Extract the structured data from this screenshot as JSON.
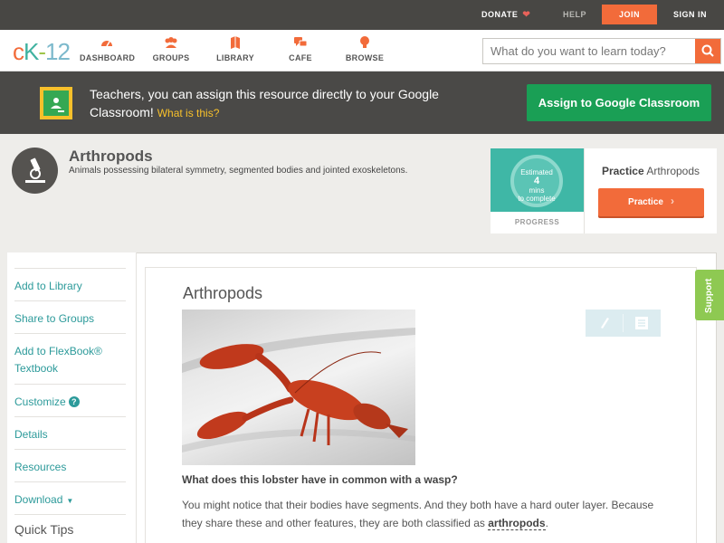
{
  "topbar": {
    "donate": "DONATE",
    "help": "HELP",
    "join": "JOIN",
    "signin": "SIGN IN"
  },
  "logo": {
    "c": "c",
    "k": "K",
    "dash": "-",
    "num": "12"
  },
  "nav": {
    "dashboard": "DASHBOARD",
    "groups": "GROUPS",
    "library": "LIBRARY",
    "cafe": "CAFE",
    "browse": "BROWSE"
  },
  "search": {
    "placeholder": "What do you want to learn today?"
  },
  "banner": {
    "text": "Teachers, you can assign this resource directly to your Google Classroom!",
    "what": "What is this?",
    "assign": "Assign to Google Classroom"
  },
  "concept": {
    "title": "Arthropods",
    "description": "Animals possessing bilateral symmetry, segmented bodies and jointed exoskeletons."
  },
  "practice": {
    "ring_line1": "Estimated",
    "ring_mins": "4",
    "ring_unit": "mins",
    "ring_line3": "to complete",
    "progress_label": "PROGRESS",
    "title_bold": "Practice",
    "title_rest": "Arthropods",
    "button": "Practice"
  },
  "sidebar": {
    "items": [
      "Add to Library",
      "Share to Groups",
      "Add to FlexBook®",
      "Textbook",
      "Customize",
      "Details",
      "Resources",
      "Download"
    ],
    "quick_tips": "Quick Tips"
  },
  "content": {
    "title": "Arthropods",
    "question": "What does this lobster have in common with a wasp?",
    "para_part1": "You might notice that their bodies have segments. And they both have a hard outer layer. Because they share these and other features, they are both classified as",
    "para_term": "arthropods",
    "para_end": "."
  },
  "support": "Support",
  "colors": {
    "accent": "#f26b3a",
    "teal": "#2c9a9a",
    "google_green": "#1a9f55",
    "support_green": "#8ec952"
  }
}
